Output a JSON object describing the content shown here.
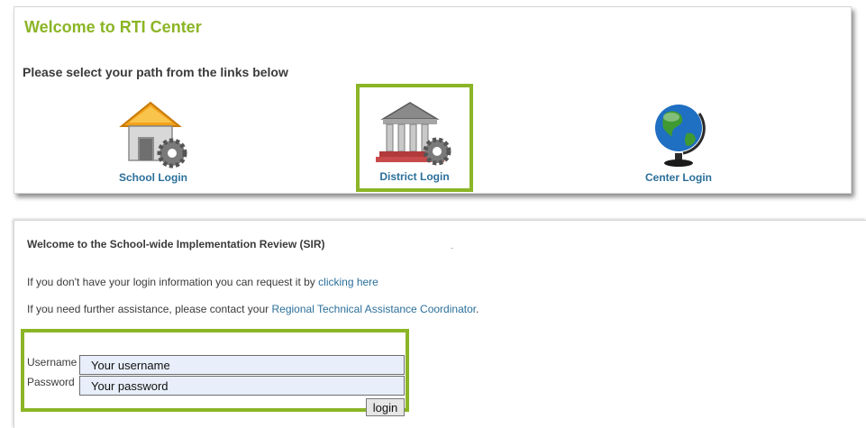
{
  "welcome": {
    "title": "Welcome to RTI Center",
    "instructions": "Please select your path from the links below"
  },
  "paths": [
    {
      "label": "School Login",
      "icon": "school-building-gear-icon"
    },
    {
      "label": "District Login",
      "icon": "district-courthouse-gear-icon",
      "highlighted": true
    },
    {
      "label": "Center Login",
      "icon": "globe-icon"
    }
  ],
  "sir": {
    "title": "Welcome to the School-wide Implementation Review (SIR)",
    "request_text": "If you don't have your login information you can request it by ",
    "request_link": "clicking here",
    "assist_text": "If you need further assistance, please contact your ",
    "assist_link": "Regional Technical Assistance Coordinator",
    "assist_end": "."
  },
  "login_form": {
    "username_label": "Username",
    "password_label": "Password",
    "username_placeholder": "Your username",
    "password_placeholder": "Your password",
    "submit_label": "login"
  },
  "colors": {
    "accent_green": "#8bb526",
    "link_blue": "#2b6f9a",
    "text_gray": "#3a3a3a",
    "input_bg": "#e8effa"
  }
}
